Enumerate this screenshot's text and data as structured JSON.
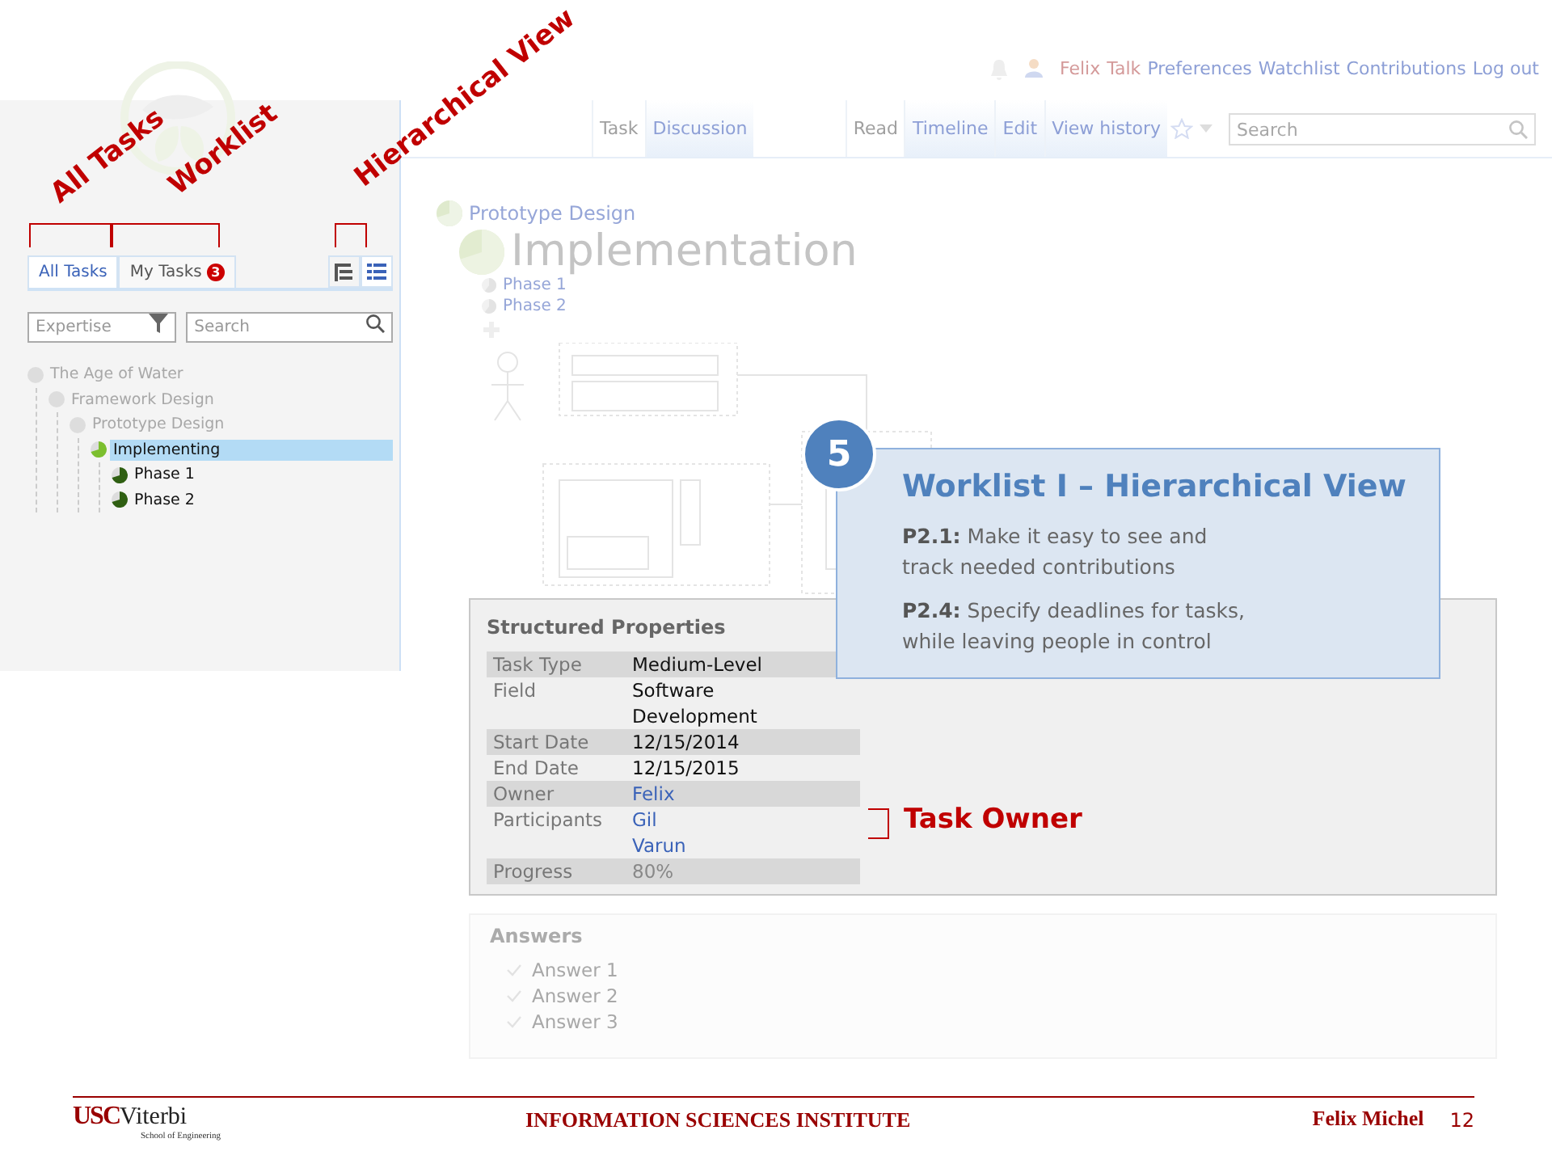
{
  "header": {
    "user_links": [
      {
        "label": "Felix",
        "kind": "user"
      },
      {
        "label": "Talk",
        "kind": "user"
      },
      {
        "label": "Preferences",
        "kind": "link"
      },
      {
        "label": "Watchlist",
        "kind": "link"
      },
      {
        "label": "Contributions",
        "kind": "link"
      },
      {
        "label": "Log out",
        "kind": "link"
      }
    ]
  },
  "page_tabs": [
    {
      "label": "Task",
      "selected": true
    },
    {
      "label": "Discussion",
      "selected": false
    }
  ],
  "view_tabs": [
    {
      "label": "Read",
      "selected": true
    },
    {
      "label": "Timeline",
      "selected": false
    },
    {
      "label": "Edit",
      "selected": false
    },
    {
      "label": "View history",
      "selected": false
    }
  ],
  "search": {
    "placeholder": "Search"
  },
  "sidebar": {
    "tabs": [
      {
        "label": "All Tasks",
        "selected": true
      },
      {
        "label": "My Tasks",
        "badge": "3",
        "selected": false
      }
    ],
    "view_buttons": [
      {
        "kind": "tree",
        "selected": false
      },
      {
        "kind": "list",
        "selected": true
      }
    ],
    "filter": {
      "placeholder": "Expertise"
    },
    "search": {
      "placeholder": "Search"
    },
    "tree": [
      {
        "label": "The Age of Water",
        "dimmed": true,
        "selected": false,
        "children": [
          {
            "label": "Framework Design",
            "dimmed": true,
            "selected": false,
            "children": [
              {
                "label": "Prototype Design",
                "dimmed": true,
                "selected": false,
                "children": [
                  {
                    "label": "Implementing",
                    "dimmed": false,
                    "selected": true,
                    "children": [
                      {
                        "label": "Phase 1",
                        "dimmed": false,
                        "selected": false
                      },
                      {
                        "label": "Phase 2",
                        "dimmed": false,
                        "selected": false
                      }
                    ]
                  }
                ]
              }
            ]
          }
        ]
      }
    ]
  },
  "task": {
    "parent": {
      "label": "Prototype Design"
    },
    "title": {
      "label": "Implementation"
    },
    "subtasks": [
      {
        "label": "Phase 1"
      },
      {
        "label": "Phase 2"
      }
    ]
  },
  "properties": {
    "title": "Structured Properties",
    "rows": [
      {
        "label": "Task Type",
        "values": [
          "Medium-Level"
        ],
        "kind": "text"
      },
      {
        "label": "Field",
        "values": [
          "Software Development"
        ],
        "kind": "text"
      },
      {
        "label": "Start Date",
        "values": [
          "12/15/2014"
        ],
        "kind": "text"
      },
      {
        "label": "End Date",
        "values": [
          "12/15/2015"
        ],
        "kind": "text"
      },
      {
        "label": "Owner",
        "values": [
          "Felix"
        ],
        "kind": "link"
      },
      {
        "label": "Participants",
        "values": [
          "Gil",
          "Varun"
        ],
        "kind": "link"
      },
      {
        "label": "Progress",
        "values": [
          "80%"
        ],
        "kind": "muted"
      }
    ]
  },
  "answers": {
    "title": "Answers",
    "items": [
      "Answer 1",
      "Answer 2",
      "Answer 3"
    ]
  },
  "callout": {
    "number": "5",
    "title": "Worklist I – Hierarchical View",
    "points": [
      "**P2.1:** Make it easy to see and track needed contributions",
      "**P2.4:** Specify deadlines for tasks, while leaving people in control"
    ]
  },
  "annotations": [
    {
      "label": "All Tasks"
    },
    {
      "label": "Worklist"
    },
    {
      "label": "Hierarchical View"
    },
    {
      "label": "Task Owner"
    }
  ],
  "footer": {
    "logo_main": "USC",
    "logo_rest": "Viterbi",
    "logo_sub": "School of Engineering",
    "institute": "INFORMATION SCIENCES INSTITUTE",
    "author": "Felix Michel",
    "page": "12"
  }
}
